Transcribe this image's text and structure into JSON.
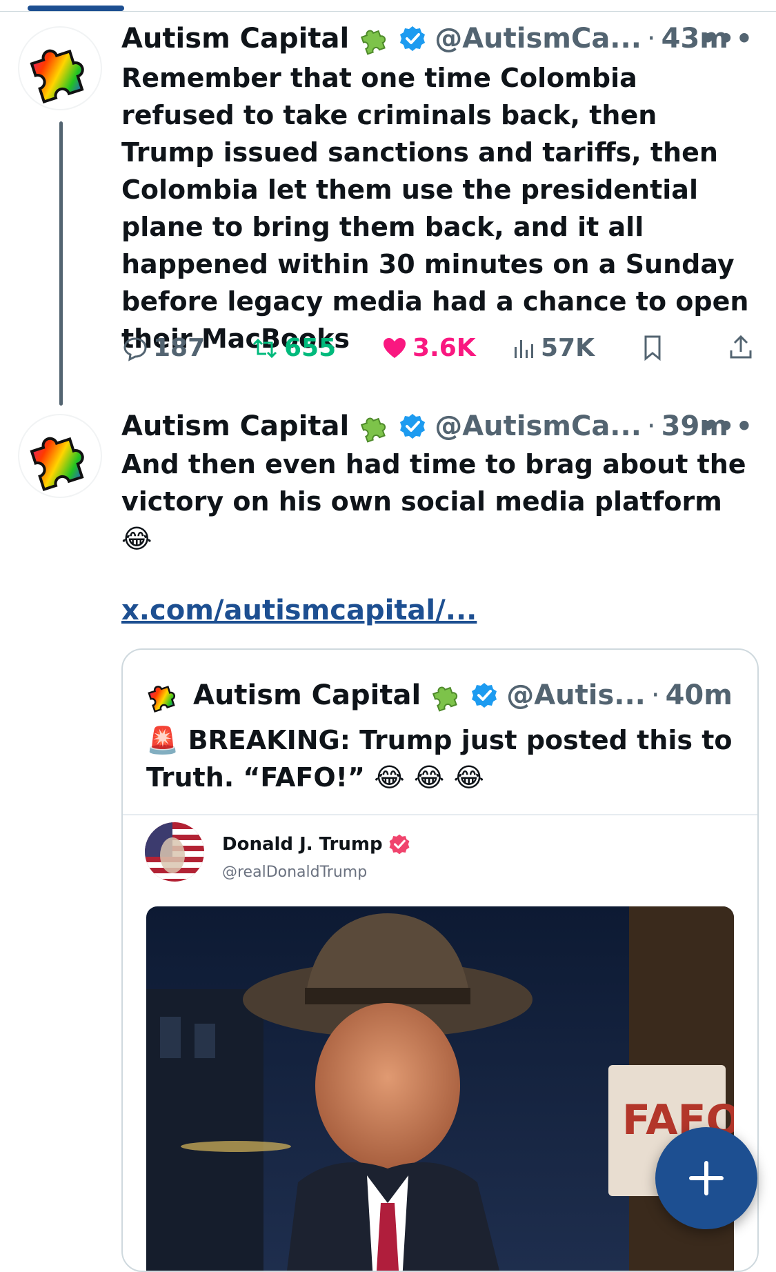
{
  "tweets": [
    {
      "author_name": "Autism Capital",
      "handle": "@AutismCa...",
      "separator": "·",
      "time": "43m",
      "text": "Remember that one time Colombia refused to take criminals back, then Trump issued sanctions and tariffs, then Colombia let them use the presidential plane to bring them back, and it all happened within 30 minutes on a Sunday before legacy media had a chance to open their MacBooks",
      "stats": {
        "replies": "187",
        "reposts": "655",
        "likes": "3.6K",
        "views": "57K"
      }
    },
    {
      "author_name": "Autism Capital",
      "handle": "@AutismCa...",
      "separator": "·",
      "time": "39m",
      "text": "And then even had time to brag about the victory on his own social media platform",
      "emoji": "😂",
      "link": "x.com/autismcapital/..."
    }
  ],
  "quoted": {
    "author_name": "Autism Capital",
    "handle": "@Autis...",
    "separator": "·",
    "time": "40m",
    "text_emoji_prefix": "🚨",
    "text": "BREAKING: Trump just posted this to Truth. “FAFO!”",
    "text_emoji_suffix": "😂 😂 😂",
    "truth_post": {
      "name": "Donald J. Trump",
      "handle": "@realDonaldTrump",
      "image_sign_text": "FAFO"
    }
  },
  "more_label": "•••",
  "icons": [
    "puzzle-icon",
    "verified-badge-icon",
    "more-icon",
    "reply-icon",
    "repost-icon",
    "like-icon",
    "views-icon",
    "bookmark-icon",
    "share-icon",
    "compose-plus-icon"
  ],
  "colors": {
    "accent": "#1d4f91",
    "verified": "#1d9bf0",
    "repost": "#00ba7c",
    "like": "#f91880",
    "muted": "#536471"
  }
}
